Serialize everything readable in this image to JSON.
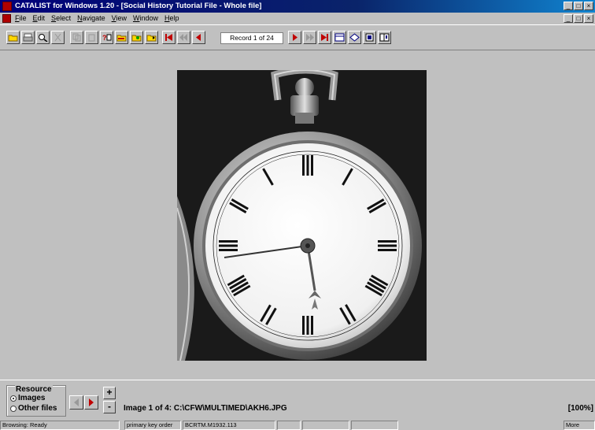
{
  "window": {
    "title": "CATALIST for Windows 1.20 - [Social History Tutorial File - Whole file]",
    "minimize": "_",
    "restore": "□",
    "close": "×"
  },
  "menu": {
    "items": [
      "File",
      "Edit",
      "Select",
      "Navigate",
      "View",
      "Window",
      "Help"
    ]
  },
  "toolbar": {
    "record_indicator": "Record 1 of 24"
  },
  "resource": {
    "title": "Resource",
    "options": [
      {
        "label": "Images",
        "selected": true
      },
      {
        "label": "Other files",
        "selected": false
      }
    ],
    "zoom_in": "+",
    "zoom_out": "-"
  },
  "image_info": {
    "caption": "Image 1 of 4: C:\\CFW\\MULTIMED\\AKH6.JPG",
    "zoom": "[100%]"
  },
  "status": {
    "state": "Browsing: Ready",
    "order": "primary key order",
    "record_key": "BCRTM.M1932.113",
    "more": "More"
  },
  "colors": {
    "title_gradient_start": "#00007b",
    "title_gradient_end": "#1084d0",
    "chrome": "#c0c0c0",
    "red_accent": "#c00000"
  },
  "icons": [
    "open-folder-icon",
    "print-icon",
    "find-icon",
    "cut-icon",
    "copy-icon",
    "paste-icon",
    "query-icon",
    "sort-icon",
    "filter-icon",
    "report-icon",
    "first-record-icon",
    "previous-icon",
    "next-icon",
    "last-record-icon",
    "form-view-icon",
    "table-view-icon",
    "book-icon",
    "image-icon"
  ]
}
